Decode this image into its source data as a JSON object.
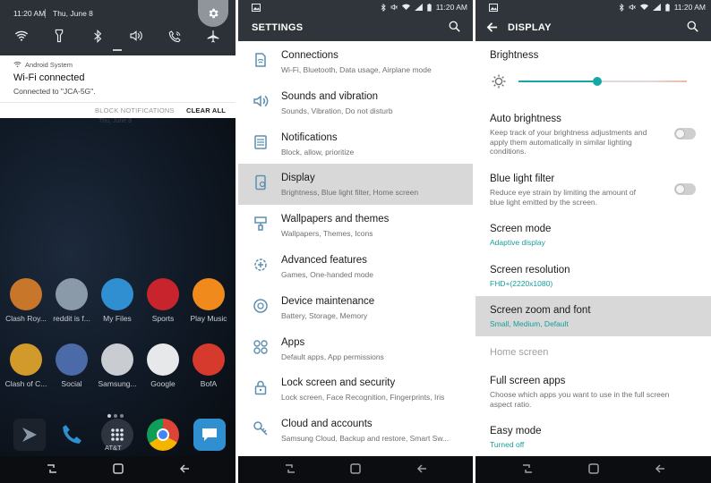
{
  "panel1": {
    "status": {
      "time": "11:20 AM",
      "date": "Thu, June 8"
    },
    "quick_settings": [
      "wifi-icon",
      "flashlight-icon",
      "bluetooth-icon",
      "sound-icon",
      "wifi-calling-icon",
      "airplane-icon"
    ],
    "notification": {
      "source": "Android System",
      "title": "Wi-Fi connected",
      "text": "Connected to \"JCA-5G\".",
      "block_label": "BLOCK NOTIFICATIONS",
      "clear_label": "CLEAR ALL"
    },
    "faint_date": "Thu, June 8",
    "apps_row1": [
      {
        "label": "Clash Roy...",
        "color": "#c8772a",
        "icon": "clash-royale-icon"
      },
      {
        "label": "reddit is f...",
        "color": "#8b9aa8",
        "icon": "reddit-icon"
      },
      {
        "label": "My Files",
        "color": "#2f8fd0",
        "icon": "download-icon"
      },
      {
        "label": "Sports",
        "color": "#c7242e",
        "icon": "sports-icon"
      },
      {
        "label": "Play Music",
        "color": "#f08a1c",
        "icon": "play-music-icon"
      }
    ],
    "apps_row2": [
      {
        "label": "Clash of C...",
        "color": "#d29a2b",
        "icon": "clash-of-clans-icon"
      },
      {
        "label": "Social",
        "color": "#4a6aa8",
        "icon": "social-folder-icon"
      },
      {
        "label": "Samsung...",
        "color": "#c9cdd2",
        "icon": "samsung-pay-icon"
      },
      {
        "label": "Google",
        "color": "#e6e8ea",
        "icon": "google-play-icon"
      },
      {
        "label": "BofA",
        "color": "#d63a2c",
        "icon": "bofa-icon"
      }
    ],
    "dock_label": "AT&T"
  },
  "panel2": {
    "status_time": "11:20 AM",
    "title": "SETTINGS",
    "items": [
      {
        "title": "Connections",
        "desc": "Wi-Fi, Bluetooth, Data usage, Airplane mode",
        "icon": "connections-icon"
      },
      {
        "title": "Sounds and vibration",
        "desc": "Sounds, Vibration, Do not disturb",
        "icon": "sound-icon"
      },
      {
        "title": "Notifications",
        "desc": "Block, allow, prioritize",
        "icon": "notifications-icon"
      },
      {
        "title": "Display",
        "desc": "Brightness, Blue light filter, Home screen",
        "icon": "display-icon"
      },
      {
        "title": "Wallpapers and themes",
        "desc": "Wallpapers, Themes, Icons",
        "icon": "brush-icon"
      },
      {
        "title": "Advanced features",
        "desc": "Games, One-handed mode",
        "icon": "gear-plus-icon"
      },
      {
        "title": "Device maintenance",
        "desc": "Battery, Storage, Memory",
        "icon": "maintenance-icon"
      },
      {
        "title": "Apps",
        "desc": "Default apps, App permissions",
        "icon": "apps-icon"
      },
      {
        "title": "Lock screen and security",
        "desc": "Lock screen, Face Recognition, Fingerprints, Iris",
        "icon": "lock-icon"
      },
      {
        "title": "Cloud and accounts",
        "desc": "Samsung Cloud, Backup and restore, Smart Sw...",
        "icon": "key-icon"
      }
    ]
  },
  "panel3": {
    "status_time": "11:20 AM",
    "title": "DISPLAY",
    "brightness_label": "Brightness",
    "brightness_level": 0.47,
    "auto_brightness": {
      "title": "Auto brightness",
      "desc1": "Keep track of your brightness adjustments and",
      "desc2": "apply them automatically in similar lighting",
      "desc3": "conditions."
    },
    "blue_light": {
      "title": "Blue light filter",
      "desc1": "Reduce eye strain by limiting the amount of",
      "desc2": "blue light emitted by the screen."
    },
    "screen_mode": {
      "title": "Screen mode",
      "value": "Adaptive display"
    },
    "screen_resolution": {
      "title": "Screen resolution",
      "value": "FHD+(2220x1080)"
    },
    "zoom_font": {
      "title": "Screen zoom and font",
      "value": "Small, Medium, Default"
    },
    "home_screen_header": "Home screen",
    "full_screen": {
      "title": "Full screen apps",
      "desc1": "Choose which apps you want to use in the full screen",
      "desc2": "aspect ratio."
    },
    "easy_mode": {
      "title": "Easy mode",
      "value": "Turned off"
    }
  },
  "colors": {
    "accent": "#16a8a4",
    "topbar": "#2f353b",
    "selected": "#d8d8d8"
  }
}
